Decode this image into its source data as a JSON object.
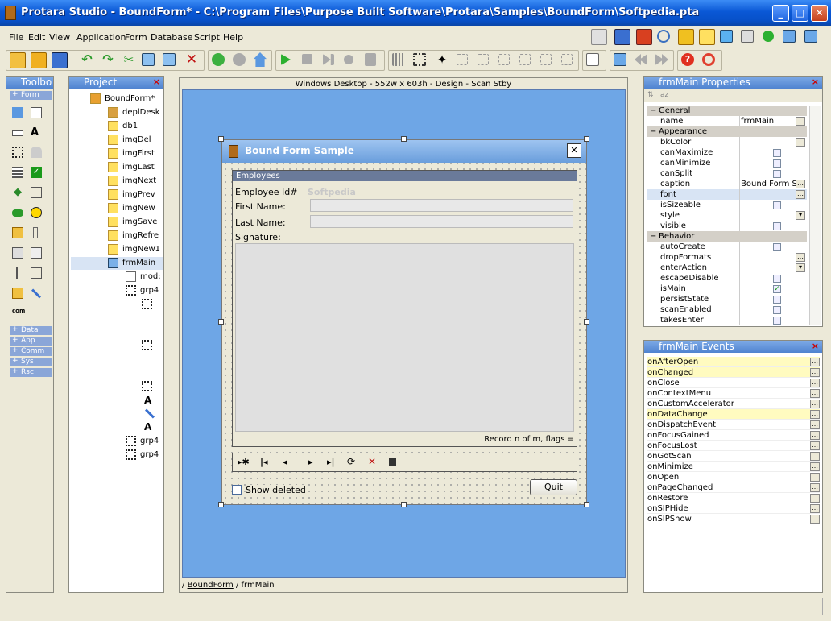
{
  "app": {
    "title": "Protara Studio - BoundForm* - C:\\Program Files\\Purpose Built Software\\Protara\\Samples\\BoundForm\\Softpedia.pta",
    "min": "_",
    "max": "□",
    "close": "✕"
  },
  "menu": [
    "File",
    "Edit",
    "View",
    "Application",
    "Form",
    "Database",
    "Script",
    "Help"
  ],
  "toolbox": {
    "title": "Toolbo",
    "form_cat": "Form",
    "cats": [
      "Data",
      "App",
      "Comm",
      "Sys",
      "Rsc"
    ]
  },
  "project": {
    "title": "Project",
    "nodes": [
      "BoundForm*",
      "deplDesk",
      "db1",
      "imgDel",
      "imgFirst",
      "imgLast",
      "imgNext",
      "imgPrev",
      "imgNew",
      "imgSave",
      "imgRefre",
      "imgNew1",
      "frmMain",
      "mod:",
      "grp4",
      "grp4",
      "grp4"
    ]
  },
  "designer": {
    "header": "Windows Desktop - 552w x 603h - Design - Scan Stby",
    "breadcrumb_root": "BoundForm",
    "breadcrumb_leaf": "frmMain"
  },
  "form": {
    "title": "Bound Form Sample",
    "close": "✕",
    "group": "Employees",
    "emp_id_label": "Employee Id#",
    "emp_id_value": "Softpedia",
    "first_label": "First Name:",
    "last_label": "Last Name:",
    "sig_label": "Signature:",
    "record": "Record n of m, flags =",
    "show_deleted": "Show deleted",
    "quit": "Quit"
  },
  "properties": {
    "title": "frmMain Properties",
    "cats": {
      "general": "General",
      "appearance": "Appearance",
      "behavior": "Behavior"
    },
    "general": [
      {
        "n": "name",
        "v": "frmMain"
      }
    ],
    "appearance": [
      {
        "n": "bkColor",
        "v": ""
      },
      {
        "n": "canMaximize",
        "v": ""
      },
      {
        "n": "canMinimize",
        "v": ""
      },
      {
        "n": "canSplit",
        "v": ""
      },
      {
        "n": "caption",
        "v": "Bound Form S"
      },
      {
        "n": "font",
        "v": ""
      },
      {
        "n": "isSizeable",
        "v": ""
      },
      {
        "n": "style",
        "v": ""
      },
      {
        "n": "visible",
        "v": ""
      }
    ],
    "behavior": [
      {
        "n": "autoCreate",
        "v": ""
      },
      {
        "n": "dropFormats",
        "v": ""
      },
      {
        "n": "enterAction",
        "v": ""
      },
      {
        "n": "escapeDisable",
        "v": ""
      },
      {
        "n": "isMain",
        "v": ""
      },
      {
        "n": "persistState",
        "v": ""
      },
      {
        "n": "scanEnabled",
        "v": ""
      },
      {
        "n": "takesEnter",
        "v": ""
      }
    ]
  },
  "events": {
    "title": "frmMain Events",
    "items": [
      "onAfterOpen",
      "onChanged",
      "onClose",
      "onContextMenu",
      "onCustomAccelerator",
      "onDataChange",
      "onDispatchEvent",
      "onFocusGained",
      "onFocusLost",
      "onGotScan",
      "onMinimize",
      "onOpen",
      "onPageChanged",
      "onRestore",
      "onSIPHide",
      "onSIPShow"
    ]
  },
  "colors": {
    "accent": "#0a58d6",
    "canvas": "#6ea6e6"
  }
}
